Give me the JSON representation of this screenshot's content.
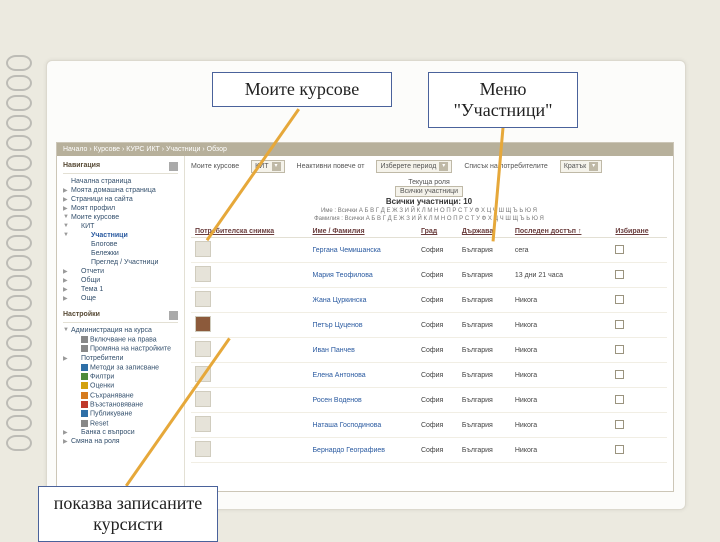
{
  "annotations": {
    "top1": "Моите курсове",
    "top2_line1": "Меню",
    "top2_line2": "\"Участници\"",
    "bottom": "показва записаните курсисти"
  },
  "breadcrumb": "Начало › Курсове › КУРС ИКТ › Участници › Обзор",
  "nav": {
    "title": "Навигация",
    "home": "Начална страница",
    "myhome": "Моята домашна страница",
    "sitepages": "Страници на сайта",
    "profile": "Моят профил",
    "mycourses": "Моите курсове",
    "course_kpi": "КИТ",
    "participants": "Участници",
    "blogs": "Блогове",
    "notes": "Бележки",
    "givenname": "Преглед / Участници",
    "reports": "Отчети",
    "common": "Общи",
    "topic1": "Тема 1",
    "more": "Още"
  },
  "settings": {
    "title": "Настройки",
    "courseadmin": "Администрация на курса",
    "editroles": "Включване на права",
    "editsettings": "Промяна на настройките",
    "users": "Потребители",
    "methods": "Методи за записване",
    "filters": "Филтри",
    "grades": "Оценки",
    "backup": "Съхраняване",
    "restore": "Възстановяване",
    "publish": "Публикуване",
    "reset": "Reset",
    "qbank": "Банка с въпроси",
    "roleswitch": "Смяна на роля"
  },
  "filters": {
    "mycourses_label": "Моите курсове",
    "mycourses_value": "КИТ",
    "inactive_label": "Неактивни повече от",
    "inactive_value": "Изберете период",
    "roles_label": "Списък на потребителите",
    "roles_value": "Кратък"
  },
  "current_role": "Текуща роля",
  "role_all_button": "Всички участници",
  "heading_all": "Всички участници: 10",
  "alpha_firstname": "Име : Всички А Б В Г Д Е Ж З И Й К Л М Н О П Р С Т У Ф Х Ц Ч Ш Щ Ъ Ь Ю Я",
  "alpha_surname": "Фамилия : Всички А Б В Г Д Е Ж З И Й К Л М Н О П Р С Т У Ф Х Ц Ч Ш Щ Ъ Ь Ю Я",
  "table": {
    "headers": {
      "pic": "Потребителска снимка",
      "name": "Име / Фамилия",
      "city": "Град",
      "country": "Държава",
      "lastaccess": "Последен достъп ↑",
      "select": "Избиране"
    },
    "rows": [
      {
        "name": "Гергана Чемишанска",
        "city": "София",
        "country": "България",
        "last": "сега",
        "on": false
      },
      {
        "name": "Мария Теофилова",
        "city": "София",
        "country": "България",
        "last": "13 дни 21 часа",
        "on": false
      },
      {
        "name": "Жана Цуркинска",
        "city": "София",
        "country": "България",
        "last": "Никога",
        "on": false
      },
      {
        "name": "Петър Цуценов",
        "city": "София",
        "country": "България",
        "last": "Никога",
        "on": true
      },
      {
        "name": "Иван Панчев",
        "city": "София",
        "country": "България",
        "last": "Никога",
        "on": false
      },
      {
        "name": "Елена Антонова",
        "city": "София",
        "country": "България",
        "last": "Никога",
        "on": false
      },
      {
        "name": "Росен Воденов",
        "city": "София",
        "country": "България",
        "last": "Никога",
        "on": false
      },
      {
        "name": "Наташа Господинова",
        "city": "София",
        "country": "България",
        "last": "Никога",
        "on": false
      },
      {
        "name": "Бернардо Географиев",
        "city": "София",
        "country": "България",
        "last": "Никога",
        "on": false
      }
    ]
  }
}
